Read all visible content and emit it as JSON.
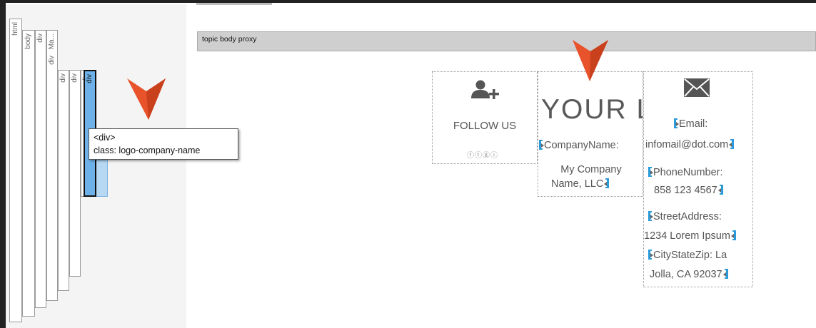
{
  "structure_panel": {
    "columns": [
      "html",
      "body",
      "div",
      "div",
      "Ma...",
      "div",
      "div",
      "div",
      "div"
    ]
  },
  "tooltip": {
    "tag": "<div>",
    "class_line": "class: logo-company-name"
  },
  "proxy_bar": {
    "label": "topic body proxy"
  },
  "follow_cell": {
    "icon": "add-user-icon",
    "label": "FOLLOW US",
    "social_placeholder": "ⓕⓣⓖⓘ"
  },
  "logo_cell": {
    "logo_text": "YOUR LOGO",
    "company_label": "CompanyName:",
    "company_value_line1": "My Company",
    "company_value_line2": "Name, LLC"
  },
  "contact_cell": {
    "icon": "envelope-icon",
    "email_label": "Email:",
    "email_value": "infomail@dot.com",
    "phone_label": "PhoneNumber:",
    "phone_value": "858 123 4567",
    "street_label": "StreetAddress:",
    "street_value": "1234 Lorem Ipsum",
    "city_label": "CityStateZip: La",
    "city_value": "Jolla, CA 92037"
  },
  "colors": {
    "selection_blue": "#6db1e8",
    "tag_bracket_blue": "#2a9bd8",
    "pointer_orange": "#e8532c"
  }
}
